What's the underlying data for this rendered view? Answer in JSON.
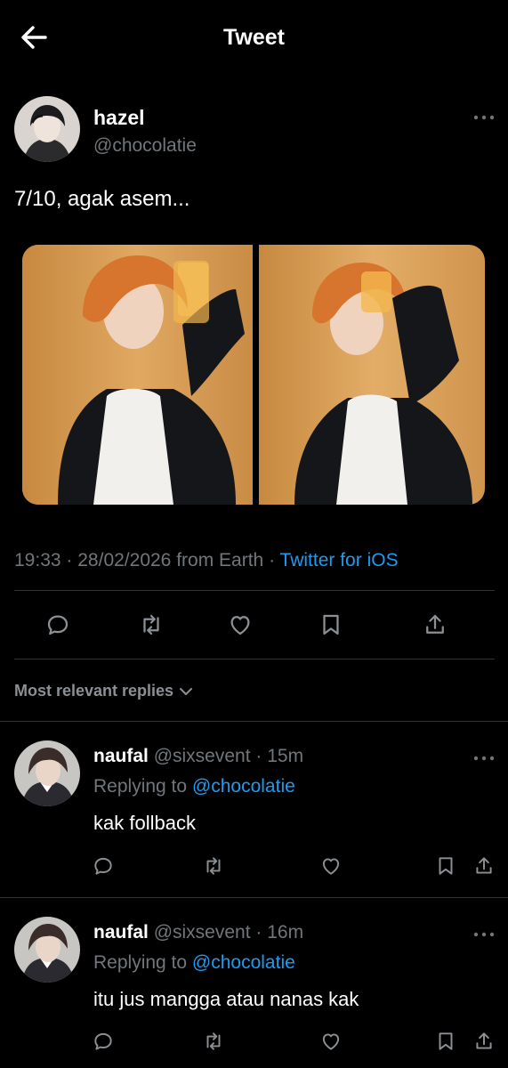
{
  "header": {
    "title": "Tweet"
  },
  "tweet": {
    "author_name": "hazel",
    "author_handle": "@chocolatie",
    "text": "7/10, agak asem...",
    "time": "19:33",
    "date": "28/02/2026",
    "location": "from Earth",
    "client": "Twitter for iOS",
    "meta_sep1": "·",
    "meta_sep2": "·"
  },
  "replies_header": {
    "label": "Most relevant replies"
  },
  "replies": [
    {
      "name": "naufal",
      "handle": "@sixsevent",
      "sep": "·",
      "age": "15m",
      "replying_prefix": "Replying to",
      "replying_to": "@chocolatie",
      "text": "kak follback"
    },
    {
      "name": "naufal",
      "handle": "@sixsevent",
      "sep": "·",
      "age": "16m",
      "replying_prefix": "Replying to",
      "replying_to": "@chocolatie",
      "text": "itu jus mangga atau nanas kak"
    }
  ],
  "icons": {
    "back": "arrow-left-icon",
    "more": "more-horizontal-icon",
    "reply": "comment-icon",
    "retweet": "retweet-icon",
    "like": "heart-icon",
    "bookmark": "bookmark-icon",
    "share": "share-icon",
    "chevron": "chevron-down-icon"
  },
  "colors": {
    "background": "#000000",
    "text": "#ffffff",
    "secondary": "#71767b",
    "link": "#1d9bf0",
    "divider": "#2f3336"
  }
}
